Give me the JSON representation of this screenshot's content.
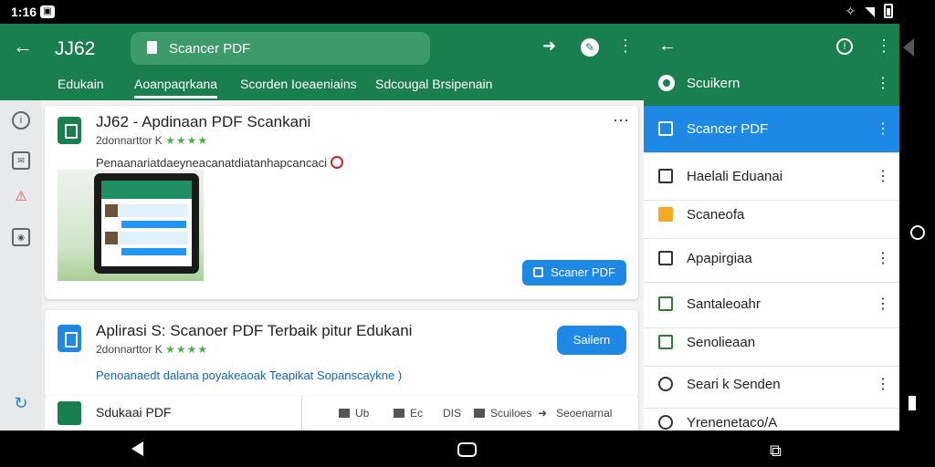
{
  "status_bar": {
    "time": "1:16",
    "notif_icon": "photo-icon",
    "icons": [
      "vibrate-icon",
      "wifi-icon",
      "battery-icon"
    ]
  },
  "app_bar": {
    "title": "JJ62",
    "search_text": "Scancer PDF",
    "actions": [
      "share-icon",
      "compass-icon",
      "more-icon"
    ]
  },
  "tabs": [
    {
      "label": "Edukain"
    },
    {
      "label": "Aoanpaqrkana",
      "active": true
    },
    {
      "label": "Scorden Ioeaeniains"
    },
    {
      "label": "Sdcougal Brsipenain"
    }
  ],
  "rail": [
    "info-icon",
    "mail-icon",
    "alert-icon",
    "camera-icon",
    "refresh-icon"
  ],
  "card1": {
    "title": "JJ62 - Apdinaan PDF Scankani",
    "developer": "2donnarttor K",
    "stars": "★★★★",
    "description": "Penaanariatdaeyneacanatdiatanhapcancaci",
    "button": "Scaner PDF"
  },
  "card2": {
    "title": "Aplirasi S: Scanoer PDF Terbaik pitur Edukani",
    "developer": "2donnarttor K",
    "stars": "★★★★",
    "link": "Penoanaedt dalana poyakeaoak Teapikat Sopanscaykne )",
    "button": "Sailern"
  },
  "card3": {
    "title": "Sdukaai PDF",
    "tools": [
      "Ub",
      "Ec",
      "DIS",
      "Scuiloes",
      "Seoenarnal"
    ]
  },
  "panel": {
    "header_label": "Scuikern",
    "items": [
      {
        "label": "Scancer PDF",
        "selected": true,
        "icon": "document-icon",
        "more": true
      },
      {
        "label": "Haelali Eduanai",
        "icon": "book-icon",
        "more": true
      },
      {
        "label": "Scaneofa",
        "icon": "folder-icon",
        "more": false
      },
      {
        "label": "Apapirgiaa",
        "icon": "camera-icon",
        "more": true
      },
      {
        "label": "Santaleoahr",
        "icon": "scan-icon",
        "more": true
      },
      {
        "label": "Senolieaan",
        "icon": "columns-icon",
        "more": false
      },
      {
        "label": "Seari k Senden",
        "icon": "settings-icon",
        "more": true
      },
      {
        "label": "Yrenenetaco/A",
        "icon": "user-icon",
        "more": false
      }
    ]
  },
  "colors": {
    "brand_green": "#1a7f4e",
    "accent_blue": "#1e88e5"
  }
}
